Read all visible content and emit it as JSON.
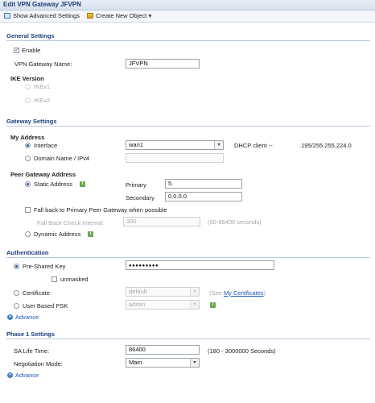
{
  "window": {
    "title": "Edit VPN Gateway JFVPN"
  },
  "toolbar": {
    "show_advanced_label": "Show Advanced Settings",
    "create_new_label": "Create New Object",
    "create_new_caret": "▾"
  },
  "general": {
    "title": "General Settings",
    "enable_label": "Enable",
    "enable_checked": true,
    "gateway_name_label": "VPN Gateway Name:",
    "gateway_name_value": "JFVPN",
    "ike_version_label": "IKE Version",
    "ikev1_label": "IKEv1",
    "ikev2_label": "IKEv2"
  },
  "gateway": {
    "title": "Gateway Settings",
    "my_address_label": "My Address",
    "interface_label": "Interface",
    "interface_value": "wan1",
    "dhcp_label": "DHCP client --",
    "dhcp_value": ".195/255.255.224.0",
    "domain_label": "Domain Name / IPv4",
    "domain_value": "",
    "peer_label": "Peer Gateway Address",
    "static_label": "Static Address",
    "primary_label": "Primary",
    "primary_value": "5.",
    "secondary_label": "Secondary",
    "secondary_value": "0.0.0.0",
    "fallback_label": "Fall back to Primary Peer Gateway when possible",
    "fallback_interval_label": "Fall Back Check Interval:",
    "fallback_interval_value": "300",
    "fallback_range": "(60-86400 seconds)",
    "dynamic_label": "Dynamic Address"
  },
  "auth": {
    "title": "Authentication",
    "psk_label": "Pre-Shared Key",
    "psk_value": "●●●●●●●●●",
    "unmasked_label": "unmasked",
    "certificate_label": "Certificate",
    "certificate_value": "default",
    "see_label": "(See",
    "my_certs_label": "My Certificates",
    "see_close": ")",
    "user_psk_label": "User Based PSK",
    "user_psk_value": "admin",
    "advance_label": "Advance"
  },
  "phase1": {
    "title": "Phase 1 Settings",
    "sa_label": "SA Life Time:",
    "sa_value": "86400",
    "sa_range": "(180 - 3000000 Seconds)",
    "neg_label": "Negotiation Mode:",
    "neg_value": "Main",
    "advance_label": "Advance"
  },
  "icons": {
    "info": "i",
    "chevron": "▾",
    "check": "✓",
    "advance": "▾"
  }
}
